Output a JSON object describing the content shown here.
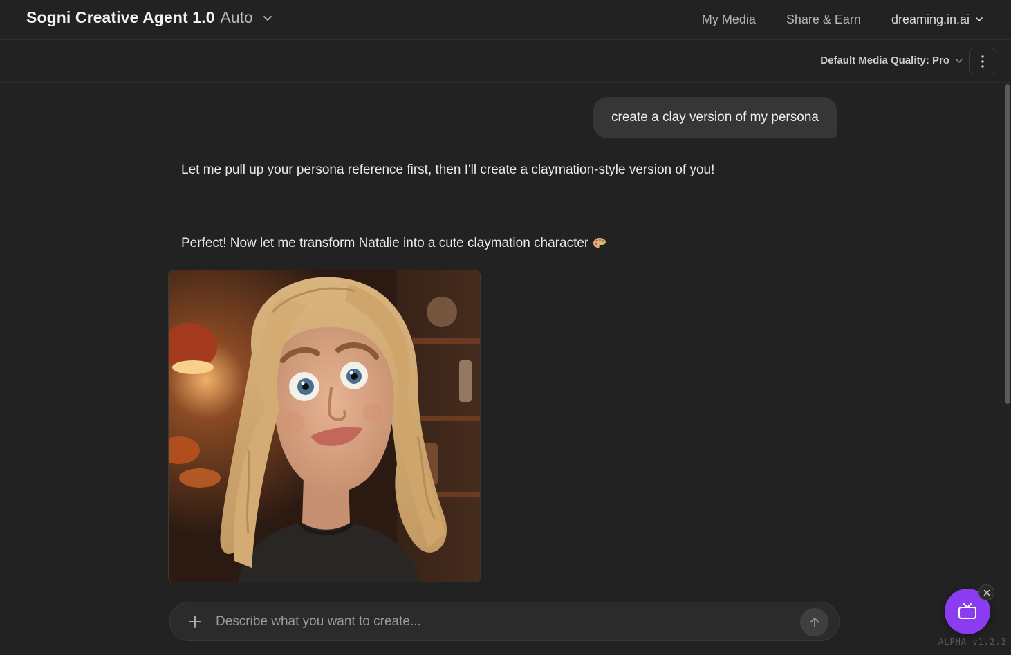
{
  "header": {
    "app_title": "Sogni Creative Agent 1.0",
    "mode": "Auto",
    "nav": {
      "my_media": "My Media",
      "share_earn": "Share & Earn",
      "account": "dreaming.in.ai"
    }
  },
  "toolbar": {
    "quality_label": "Default Media Quality: Pro"
  },
  "chat": {
    "user_message": "create a clay version of my persona",
    "assistant_message_1": "Let me pull up your persona reference first, then I'll create a claymation-style version of you!",
    "assistant_message_2": "Perfect! Now let me transform Natalie into a cute claymation character",
    "assistant_message_2_emoji": "palette-icon"
  },
  "composer": {
    "placeholder": "Describe what you want to create...",
    "value": ""
  },
  "footer": {
    "version": "ALPHA v1.2.3"
  },
  "icons": {
    "mode_dropdown": "chevron-down-icon",
    "account_dropdown": "chevron-down-icon",
    "more": "kebab-icon",
    "attach": "plus-icon",
    "send": "arrow-up-icon",
    "fab": "tv-icon",
    "fab_close": "close-icon"
  },
  "colors": {
    "background": "#222222",
    "user_bubble": "#363636",
    "accent": "#8b3cf0"
  }
}
